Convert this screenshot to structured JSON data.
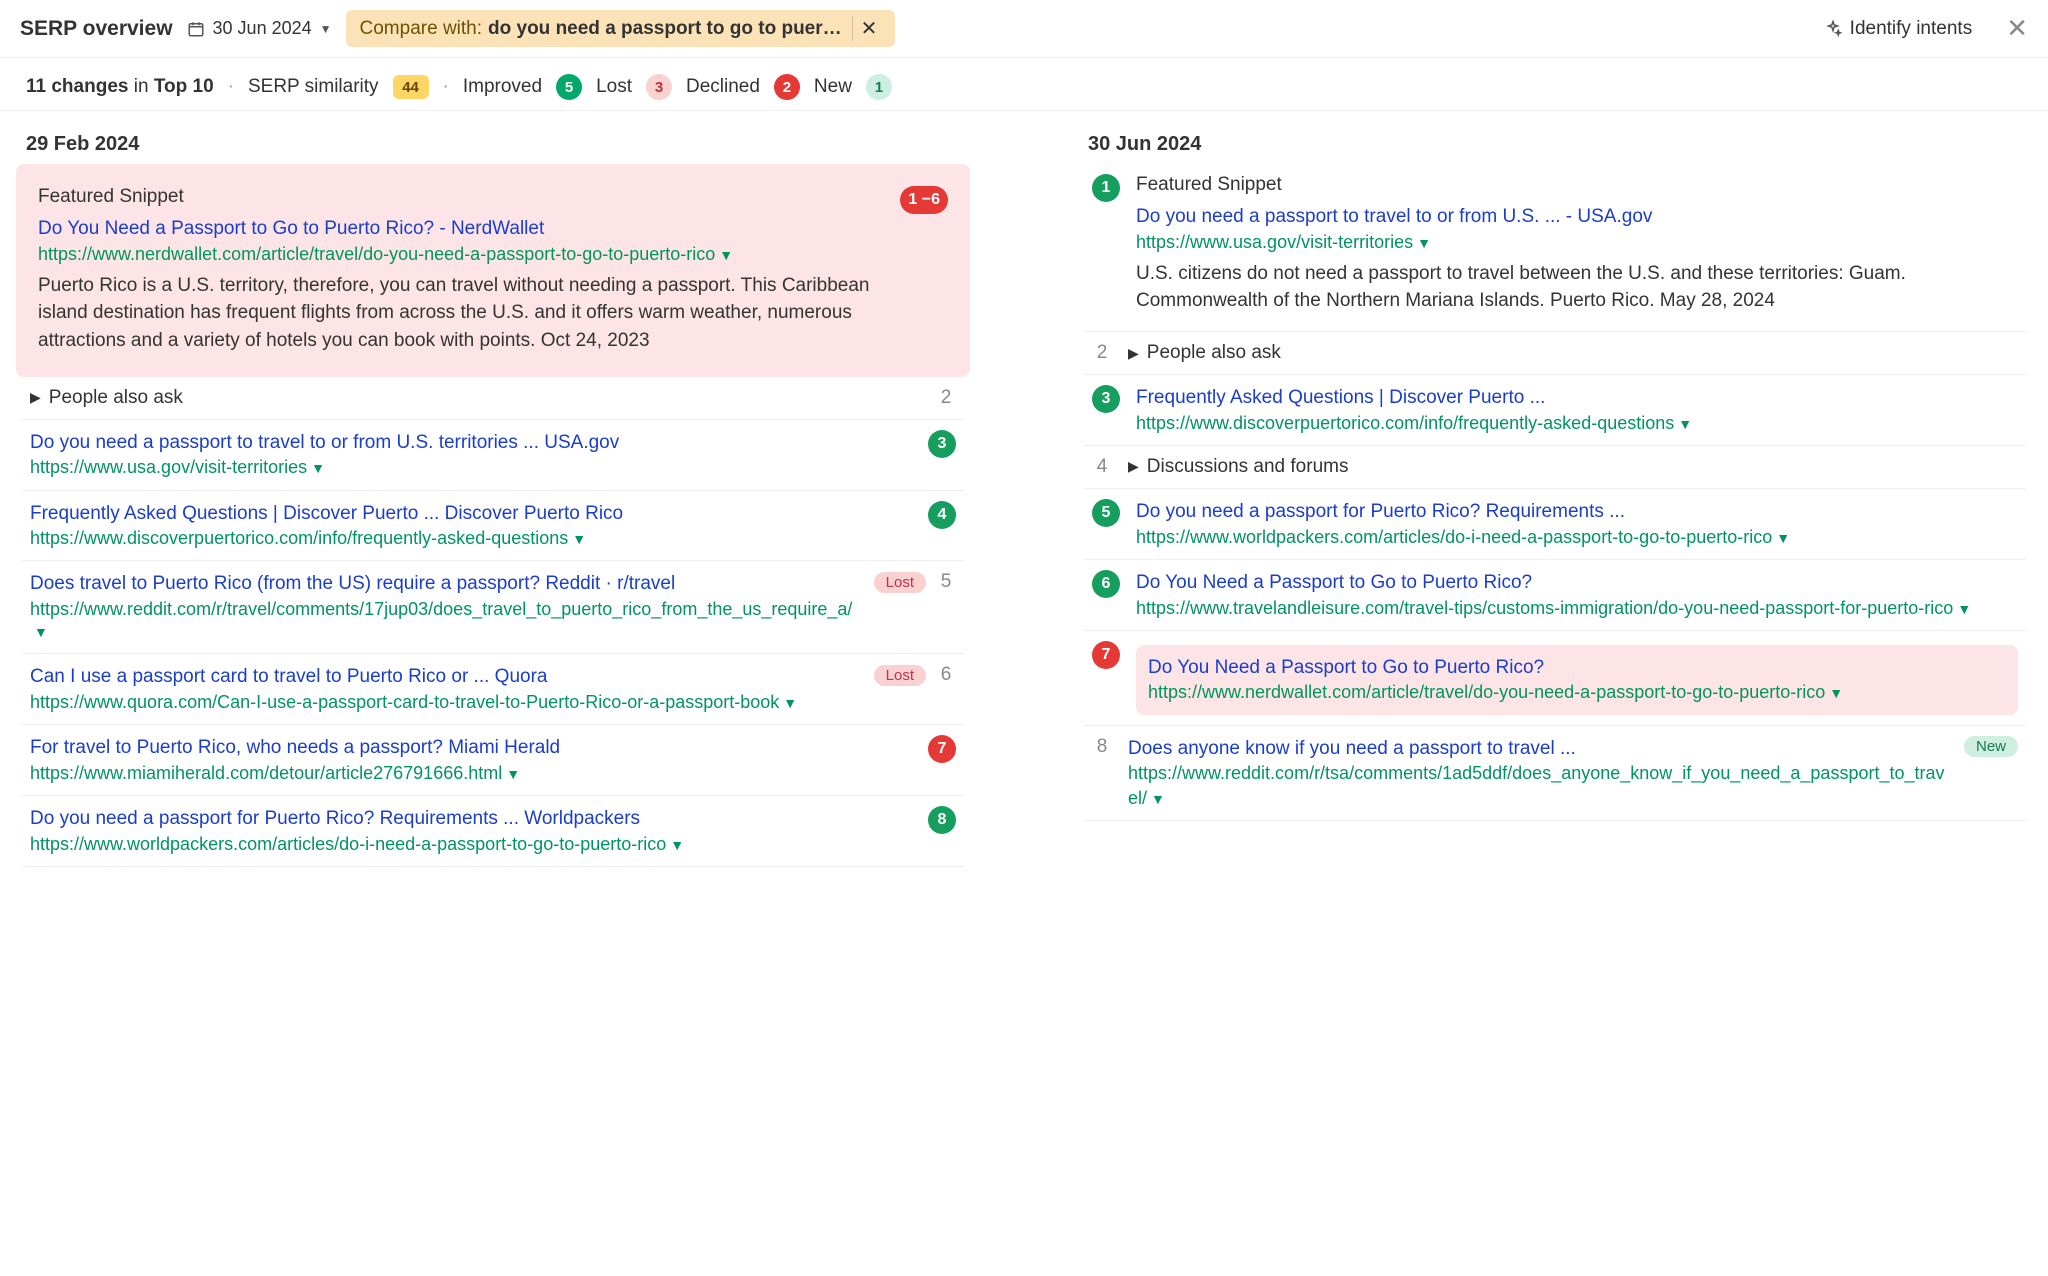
{
  "header": {
    "title": "SERP overview",
    "date": "30 Jun 2024",
    "compare_label": "Compare with:",
    "compare_query": "do you need a passport to go to puer…",
    "identify_intents": "Identify intents"
  },
  "stats": {
    "changes_count": "11 changes",
    "changes_scope": "Top 10",
    "in_word": "in",
    "similarity_label": "SERP similarity",
    "similarity_value": "44",
    "improved_label": "Improved",
    "improved_value": "5",
    "lost_label": "Lost",
    "lost_value": "3",
    "declined_label": "Declined",
    "declined_value": "2",
    "new_label": "New",
    "new_value": "1"
  },
  "left": {
    "date": "29 Feb 2024",
    "featured_label": "Featured Snippet",
    "featured_pos": "1 −6",
    "featured_title": "Do You Need a Passport to Go to Puerto Rico? - NerdWallet",
    "featured_url": "https://www.nerdwallet.com/article/travel/do-you-need-a-passport-to-go-to-puerto-rico",
    "featured_snippet": "Puerto Rico is a U.S. territory, therefore, you can travel without needing a passport. This Caribbean island destination has frequent flights from across the U.S. and it offers warm weather, numerous attractions and a variety of hotels you can book with points. Oct 24, 2023",
    "paa_label": "People also ask",
    "paa_pos": "2",
    "r3_title": "Do you need a passport to travel to or from U.S. territories ... USA.gov",
    "r3_url": "https://www.usa.gov/visit-territories",
    "r3_pos": "3",
    "r4_title": "Frequently Asked Questions | Discover Puerto ... Discover Puerto Rico",
    "r4_url": "https://www.discoverpuertorico.com/info/frequently-asked-questions",
    "r4_pos": "4",
    "r5_title": "Does travel to Puerto Rico (from the US) require a passport? Reddit · r/travel",
    "r5_url": "https://www.reddit.com/r/travel/comments/17jup03/does_travel_to_puerto_rico_from_the_us_require_a/",
    "r5_pos": "5",
    "r5_chip": "Lost",
    "r6_title": "Can I use a passport card to travel to Puerto Rico or ... Quora",
    "r6_url": "https://www.quora.com/Can-I-use-a-passport-card-to-travel-to-Puerto-Rico-or-a-passport-book",
    "r6_pos": "6",
    "r6_chip": "Lost",
    "r7_title": "For travel to Puerto Rico, who needs a passport? Miami Herald",
    "r7_url": "https://www.miamiherald.com/detour/article276791666.html",
    "r7_pos": "7",
    "r8_title": "Do you need a passport for Puerto Rico? Requirements ... Worldpackers",
    "r8_url": "https://www.worldpackers.com/articles/do-i-need-a-passport-to-go-to-puerto-rico",
    "r8_pos": "8"
  },
  "right": {
    "date": "30 Jun 2024",
    "featured_label": "Featured Snippet",
    "featured_pos": "1",
    "featured_title": "Do you need a passport to travel to or from U.S. ... - USA.gov",
    "featured_url": "https://www.usa.gov/visit-territories",
    "featured_snippet": "U.S. citizens do not need a passport to travel between the U.S. and these territories: Guam. Commonwealth of the Northern Mariana Islands. Puerto Rico. May 28, 2024",
    "paa_label": "People also ask",
    "paa_pos": "2",
    "r3_title": "Frequently Asked Questions | Discover Puerto ...",
    "r3_url": "https://www.discoverpuertorico.com/info/frequently-asked-questions",
    "r3_pos": "3",
    "daf_label": "Discussions and forums",
    "daf_pos": "4",
    "r5_title": "Do you need a passport for Puerto Rico? Requirements ...",
    "r5_url": "https://www.worldpackers.com/articles/do-i-need-a-passport-to-go-to-puerto-rico",
    "r5_pos": "5",
    "r6_title": "Do You Need a Passport to Go to Puerto Rico?",
    "r6_url": "https://www.travelandleisure.com/travel-tips/customs-immigration/do-you-need-passport-for-puerto-rico",
    "r6_pos": "6",
    "r7_title": "Do You Need a Passport to Go to Puerto Rico?",
    "r7_url": "https://www.nerdwallet.com/article/travel/do-you-need-a-passport-to-go-to-puerto-rico",
    "r7_pos": "7",
    "r8_title": "Does anyone know if you need a passport to travel ...",
    "r8_url": "https://www.reddit.com/r/tsa/comments/1ad5ddf/does_anyone_know_if_you_need_a_passport_to_travel/",
    "r8_pos": "8",
    "r8_chip": "New"
  }
}
